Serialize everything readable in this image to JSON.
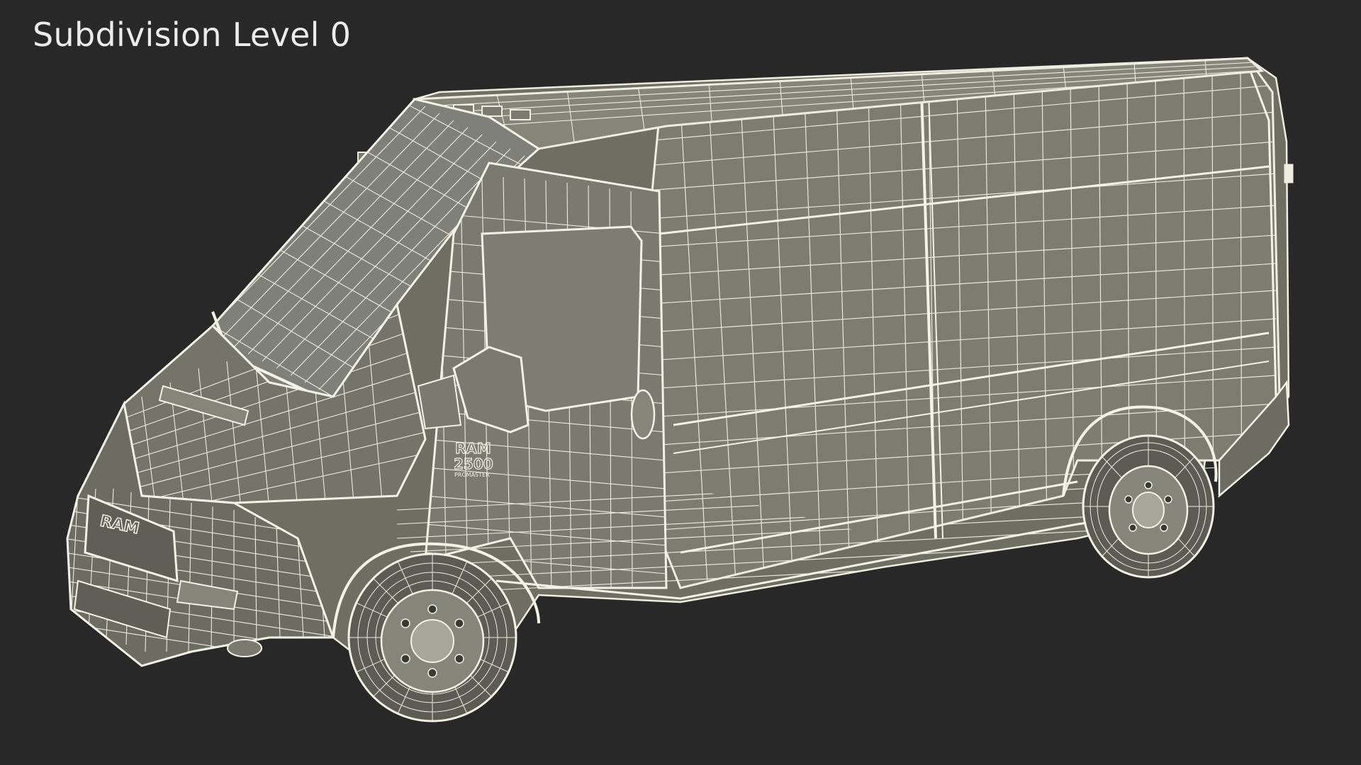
{
  "viewport": {
    "caption": "Subdivision Level 0",
    "background_color": "#282828",
    "wire_color": "#efece0",
    "surface_color": "#7b7b70",
    "render_mode": "wireframe-over-shaded"
  },
  "model": {
    "subject": "cargo-van",
    "badges": {
      "grille_logo": "RAM",
      "side_badge_model": "RAM",
      "side_badge_number": "2500",
      "side_badge_line": "PROMASTER"
    }
  }
}
